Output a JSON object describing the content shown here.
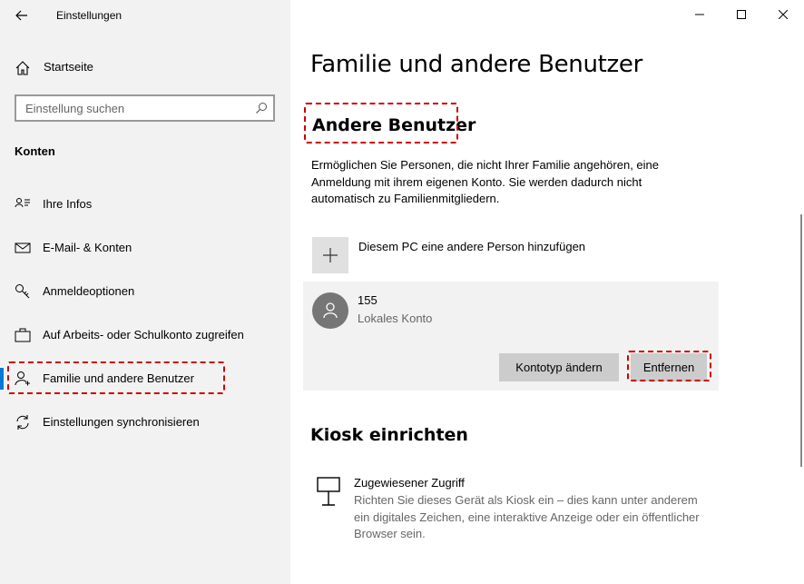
{
  "window": {
    "title": "Einstellungen"
  },
  "sidebar": {
    "home_label": "Startseite",
    "search_placeholder": "Einstellung suchen",
    "section_label": "Konten",
    "items": [
      {
        "label": "Ihre Infos",
        "icon": "person-card-icon"
      },
      {
        "label": "E-Mail- & Konten",
        "icon": "mail-icon"
      },
      {
        "label": "Anmeldeoptionen",
        "icon": "key-icon"
      },
      {
        "label": "Auf Arbeits- oder Schulkonto zugreifen",
        "icon": "briefcase-icon"
      },
      {
        "label": "Familie und andere Benutzer",
        "icon": "person-add-icon",
        "selected": true
      },
      {
        "label": "Einstellungen synchronisieren",
        "icon": "sync-icon"
      }
    ]
  },
  "main": {
    "title": "Familie und andere Benutzer",
    "other_users": {
      "heading": "Andere Benutzer",
      "description": "Ermöglichen Sie Personen, die nicht Ihrer Familie angehören, eine Anmeldung mit ihrem eigenen Konto. Sie werden dadurch nicht automatisch zu Familienmitgliedern.",
      "add_label": "Diesem PC eine andere Person hinzufügen",
      "user": {
        "name": "155",
        "type": "Lokales Konto",
        "change_type_label": "Kontotyp ändern",
        "remove_label": "Entfernen"
      }
    },
    "kiosk": {
      "heading": "Kiosk einrichten",
      "item_label": "Zugewiesener Zugriff",
      "item_description": "Richten Sie dieses Gerät als Kiosk ein – dies kann unter anderem ein digitales Zeichen, eine interaktive Anzeige oder ein öffentlicher Browser sein."
    }
  },
  "colors": {
    "accent": "#0078d7",
    "highlight": "#cc0000",
    "sidebar_bg": "#f2f2f2"
  }
}
